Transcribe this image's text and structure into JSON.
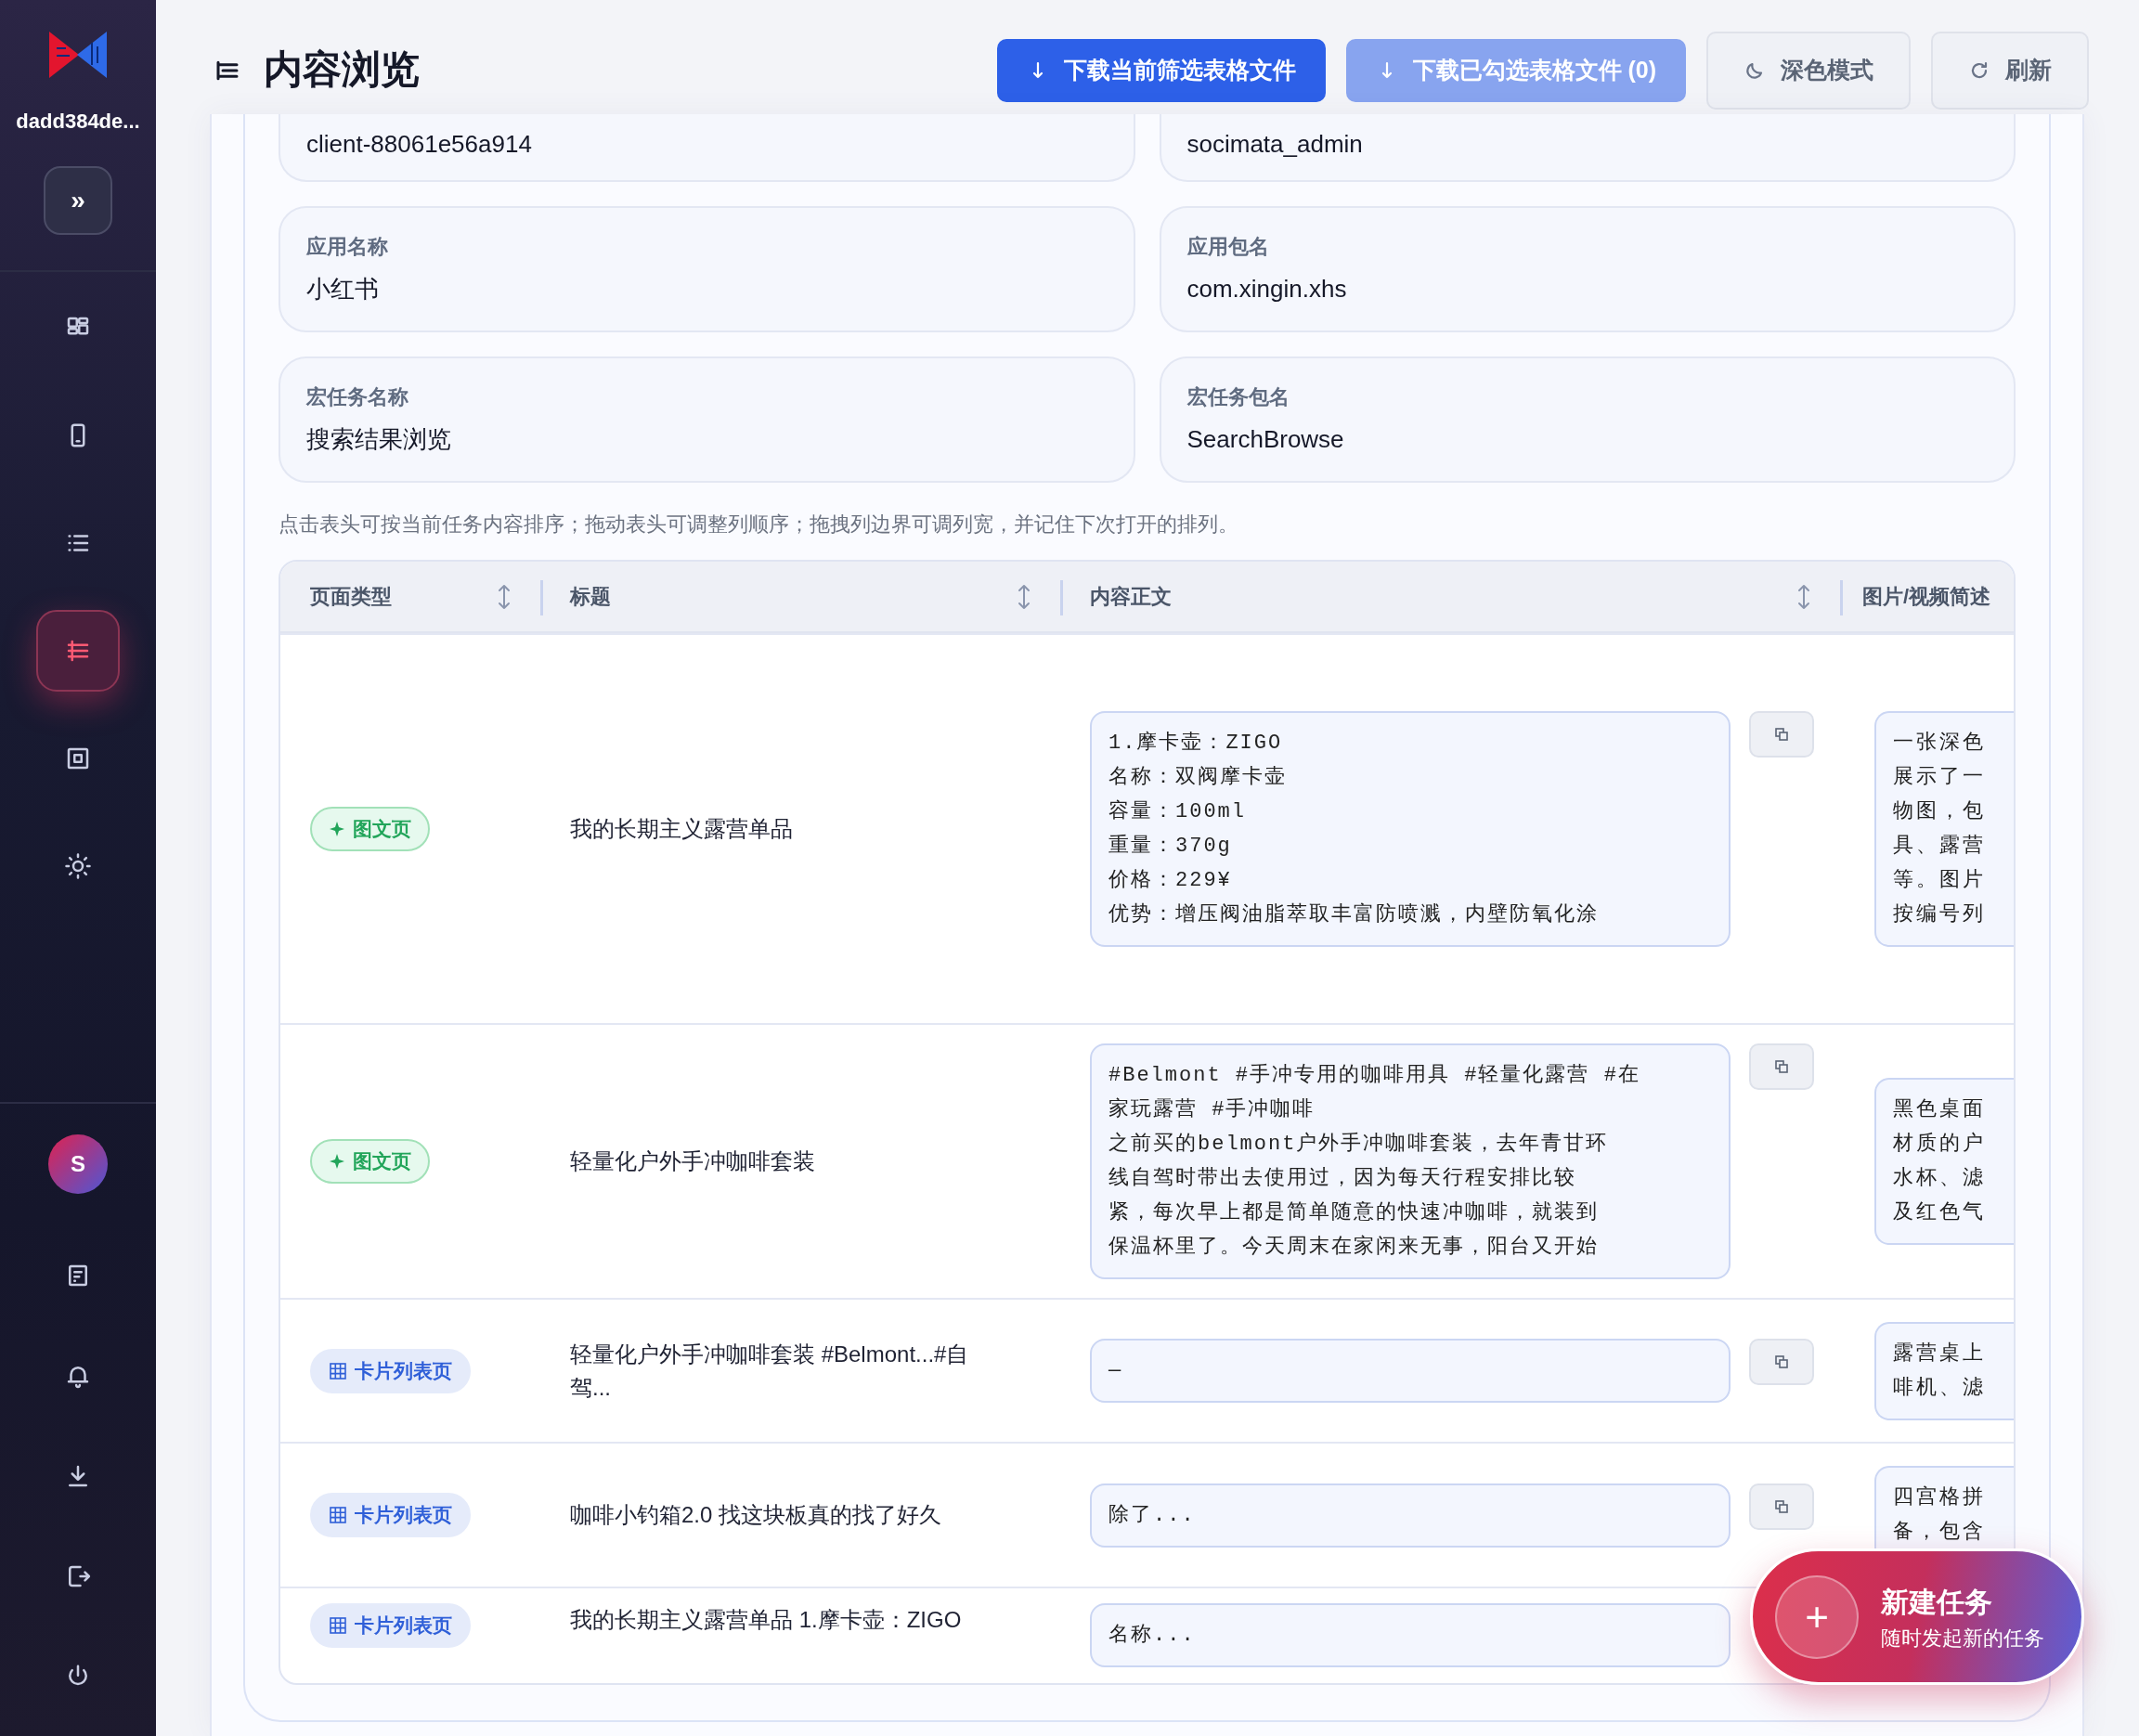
{
  "sidebar": {
    "device_name": "dadd384de...",
    "expand_button": "»",
    "nav": [
      {
        "selected": false
      },
      {
        "selected": false
      },
      {
        "selected": false
      },
      {
        "selected": true
      },
      {
        "selected": false
      },
      {
        "selected": false
      }
    ],
    "avatar": "S"
  },
  "header": {
    "title": "内容浏览",
    "buttons": [
      {
        "label": "下载当前筛选表格文件",
        "kind": "primary",
        "disabled": false
      },
      {
        "label": "下载已勾选表格文件 (0)",
        "kind": "primary",
        "disabled": true
      },
      {
        "label": "深色模式",
        "kind": "outline",
        "disabled": false
      },
      {
        "label": "刷新",
        "kind": "outline",
        "disabled": false
      }
    ]
  },
  "info_fields": [
    {
      "value": "client-88061e56a914"
    },
    {
      "value": "socimata_admin"
    },
    {
      "label": "应用名称",
      "value": "小红书"
    },
    {
      "label": "应用包名",
      "value": "com.xingin.xhs"
    },
    {
      "label": "宏任务名称",
      "value": "搜索结果浏览"
    },
    {
      "label": "宏任务包名",
      "value": "SearchBrowse"
    }
  ],
  "hint": "点击表头可按当前任务内容排序；拖动表头可调整列顺序；拖拽列边界可调列宽，并记住下次打开的排列。",
  "table": {
    "columns": [
      {
        "label": "页面类型",
        "sortable": true
      },
      {
        "label": "标题",
        "sortable": true
      },
      {
        "label": "内容正文",
        "sortable": true
      },
      {
        "label": "图片/视频简述",
        "sortable": false
      }
    ],
    "rows": [
      {
        "page_type": {
          "label": "图文页",
          "kind": "article"
        },
        "title": "我的长期主义露营单品",
        "content": [
          "1.摩卡壶：ZIGO",
          "名称：双阀摩卡壶",
          "容量：100ml",
          "重量：370g",
          "价格：229¥",
          "优势：增压阀油脂萃取丰富防喷溅，内壁防氧化涂"
        ],
        "copy_button": true,
        "media_description": [
          "一张深色",
          "展示了一",
          "物图，包",
          "具、露营",
          "等。图片",
          "按编号列"
        ]
      },
      {
        "page_type": {
          "label": "图文页",
          "kind": "article"
        },
        "title": "轻量化户外手冲咖啡套装",
        "content": [
          "#Belmont #手冲专用的咖啡用具 #轻量化露营 #在",
          "家玩露营 #手冲咖啡",
          "之前买的belmont户外手冲咖啡套装，去年青甘环",
          "线自驾时带出去使用过，因为每天行程安排比较",
          "紧，每次早上都是简单随意的快速冲咖啡，就装到",
          "保温杯里了。今天周末在家闲来无事，阳台又开始"
        ],
        "copy_button": true,
        "media_description": [
          "黑色桌面",
          "材质的户",
          "水杯、滤",
          "及红色气"
        ]
      },
      {
        "page_type": {
          "label": "卡片列表页",
          "kind": "card_list"
        },
        "title": "轻量化户外手冲咖啡套装 #Belmont...#自驾...",
        "content": [
          "—"
        ],
        "copy_button": true,
        "media_description": [
          "露营桌上",
          "啡机、滤"
        ]
      },
      {
        "page_type": {
          "label": "卡片列表页",
          "kind": "card_list"
        },
        "title": "咖啡小钓箱2.0 找这块板真的找了好久",
        "content": [
          "除了..."
        ],
        "copy_button": true,
        "media_description": [
          "四宫格拼",
          "备，包含"
        ]
      },
      {
        "page_type": {
          "label": "卡片列表页",
          "kind": "card_list"
        },
        "title": "我的长期主义露营单品 1.摩卡壶：ZIGO",
        "content": [
          "名称..."
        ],
        "copy_button": false
      }
    ]
  },
  "fab": {
    "icon": "+",
    "title": "新建任务",
    "subtitle": "随时发起新的任务"
  }
}
